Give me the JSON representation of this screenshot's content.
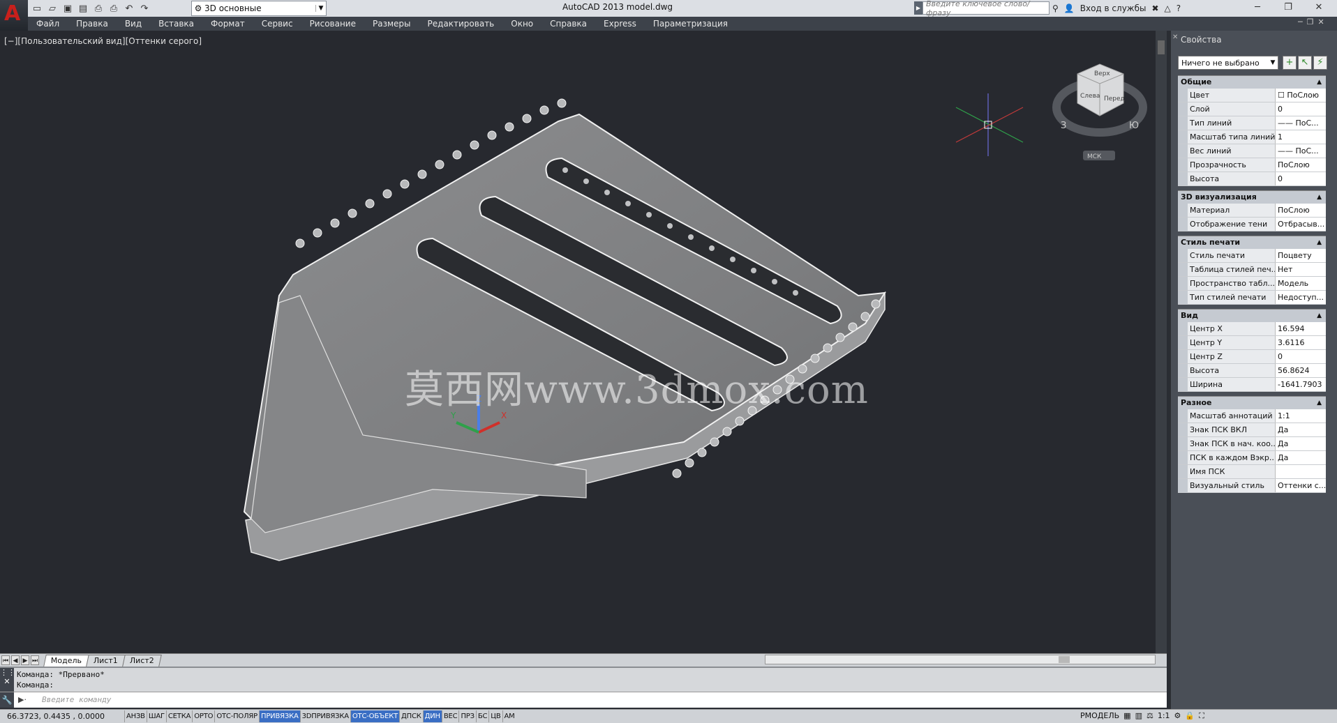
{
  "app": {
    "title": "AutoCAD 2013    model.dwg",
    "logo_letter": "A"
  },
  "workspace": {
    "value": "3D основные"
  },
  "search": {
    "placeholder": "Введите ключевое слово/фразу"
  },
  "help_tools": {
    "signin": "Вход в службы"
  },
  "menu": [
    "Файл",
    "Правка",
    "Вид",
    "Вставка",
    "Формат",
    "Сервис",
    "Рисование",
    "Размеры",
    "Редактировать",
    "Окно",
    "Справка",
    "Express",
    "Параметризация"
  ],
  "viewport": {
    "label": "[−][Пользовательский вид][Оттенки серого]",
    "watermark": "莫西网www.3dmox.com",
    "viewcube": {
      "top": "Верх",
      "left": "Слева",
      "front": "Перед",
      "west": "З",
      "south": "Ю",
      "wcs": "МСК"
    },
    "ucs": {
      "x": "X",
      "y": "Y",
      "z": "Z"
    }
  },
  "tabs": [
    "Модель",
    "Лист1",
    "Лист2"
  ],
  "command": {
    "history": [
      "Команда:  *Прервано*",
      "Команда:"
    ],
    "placeholder": "Введите команду"
  },
  "status": {
    "coords": "66.3723, 0.4435 , 0.0000",
    "toggles": [
      {
        "label": "АНЗВ",
        "on": false
      },
      {
        "label": "ШАГ",
        "on": false
      },
      {
        "label": "СЕТКА",
        "on": false
      },
      {
        "label": "ОРТО",
        "on": false
      },
      {
        "label": "ОТС-ПОЛЯР",
        "on": false
      },
      {
        "label": "ПРИВЯЗКА",
        "on": true
      },
      {
        "label": "3DПРИВЯЗКА",
        "on": false
      },
      {
        "label": "ОТС-ОБЪЕКТ",
        "on": true
      },
      {
        "label": "ДПСК",
        "on": false
      },
      {
        "label": "ДИН",
        "on": true
      },
      {
        "label": "ВЕС",
        "on": false
      },
      {
        "label": "ПРЗ",
        "on": false
      },
      {
        "label": "БС",
        "on": false
      },
      {
        "label": "ЦВ",
        "on": false
      },
      {
        "label": "АМ",
        "on": false
      }
    ],
    "right_label": "РМОДЕЛЬ",
    "scale": "1:1"
  },
  "properties": {
    "title": "Свойства",
    "selection": "Ничего не выбрано",
    "sections": [
      {
        "name": "Общие",
        "rows": [
          {
            "k": "Цвет",
            "v": "☐ ПоСлою"
          },
          {
            "k": "Слой",
            "v": "0"
          },
          {
            "k": "Тип линий",
            "v": "—— ПоС..."
          },
          {
            "k": "Масштаб типа линий",
            "v": "1"
          },
          {
            "k": "Вес линий",
            "v": "—— ПоС..."
          },
          {
            "k": "Прозрачность",
            "v": "ПоСлою"
          },
          {
            "k": "Высота",
            "v": "0"
          }
        ]
      },
      {
        "name": "3D визуализация",
        "rows": [
          {
            "k": "Материал",
            "v": "ПоСлою"
          },
          {
            "k": "Отображение тени",
            "v": "Отбрасыв..."
          }
        ]
      },
      {
        "name": "Стиль печати",
        "rows": [
          {
            "k": "Стиль печати",
            "v": "Поцвету"
          },
          {
            "k": "Таблица стилей печ...",
            "v": "Нет"
          },
          {
            "k": "Пространство табл...",
            "v": "Модель"
          },
          {
            "k": "Тип стилей печати",
            "v": "Недоступ..."
          }
        ]
      },
      {
        "name": "Вид",
        "rows": [
          {
            "k": "Центр X",
            "v": "16.594"
          },
          {
            "k": "Центр Y",
            "v": "3.6116"
          },
          {
            "k": "Центр Z",
            "v": "0"
          },
          {
            "k": "Высота",
            "v": "56.8624"
          },
          {
            "k": "Ширина",
            "v": "-1641.7903"
          }
        ]
      },
      {
        "name": "Разное",
        "rows": [
          {
            "k": "Масштаб аннотаций",
            "v": "1:1"
          },
          {
            "k": "Знак ПСК ВКЛ",
            "v": "Да"
          },
          {
            "k": "Знак ПСК в нач. коо...",
            "v": "Да"
          },
          {
            "k": "ПСК в каждом Вэкр...",
            "v": "Да"
          },
          {
            "k": "Имя ПСК",
            "v": ""
          },
          {
            "k": "Визуальный стиль",
            "v": "Оттенки с..."
          }
        ]
      }
    ]
  }
}
